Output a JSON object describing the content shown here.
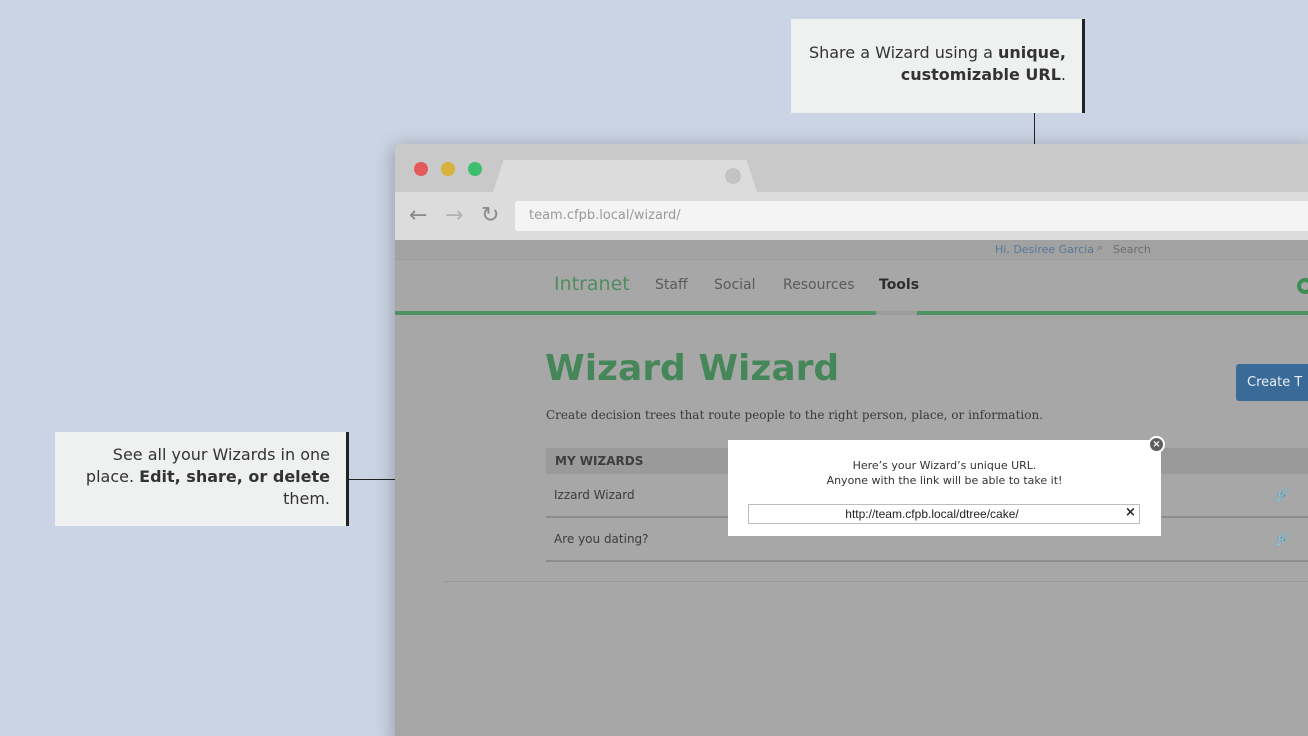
{
  "callouts": {
    "top": {
      "text": "Share a Wizard using a ",
      "bold": "unique, customizable URL",
      "tail": "."
    },
    "left": {
      "text": "See all your Wizards in one place. ",
      "bold": "Edit, share, or delete",
      "tail": " them."
    }
  },
  "browser": {
    "url": "team.cfpb.local/wizard/",
    "back_icon": "←",
    "forward_icon": "→",
    "reload_icon": "↻"
  },
  "userbar": {
    "greeting": "Hi, Desiree Garcia",
    "search_icon": "⌕",
    "search_placeholder": "Search"
  },
  "nav": {
    "brand": "Intranet",
    "items": [
      "Staff",
      "Social",
      "Resources",
      "Tools"
    ]
  },
  "page": {
    "title": "Wizard Wizard",
    "subtitle": "Create decision trees that route people to the right person, place, or information.",
    "create_button": "Create T"
  },
  "table": {
    "header": "MY WIZARDS",
    "rows": [
      {
        "name": "Izzard Wizard"
      },
      {
        "name": "Are you dating?"
      }
    ],
    "row_icon": "🔗"
  },
  "modal": {
    "line1": "Here’s your Wizard’s unique URL.",
    "line2": "Anyone with the link will be able to take it!",
    "url_value": "http://team.cfpb.local/dtree/cake/",
    "clear_icon": "×",
    "close_icon": "×"
  },
  "colors": {
    "background": "#cbd4e4",
    "brand_green": "#46875a",
    "button_blue": "#3a6b98"
  }
}
